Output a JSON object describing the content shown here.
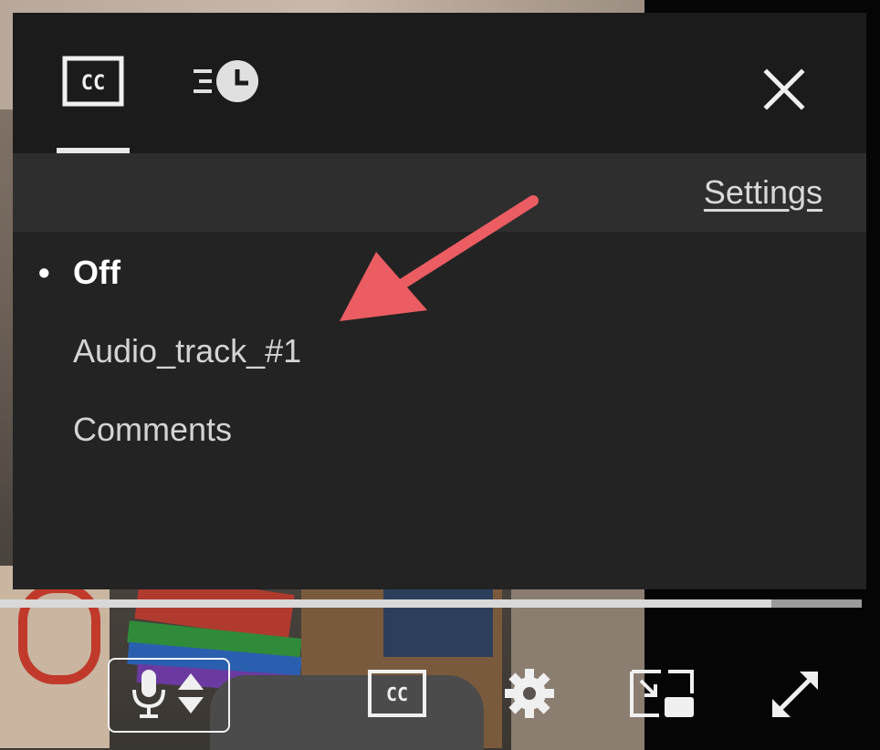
{
  "panel": {
    "tabs": [
      {
        "name": "captions",
        "icon": "closed-captions-icon",
        "selected": true
      },
      {
        "name": "speed",
        "icon": "playback-speed-icon",
        "selected": false
      }
    ],
    "close_icon": "close-icon",
    "settings_label": "Settings",
    "options": [
      {
        "label": "Off",
        "selected": true
      },
      {
        "label": "Audio_track_#1",
        "selected": false
      },
      {
        "label": "Comments",
        "selected": false
      }
    ],
    "bullet": "•"
  },
  "player": {
    "progress": 0.895,
    "controls": [
      {
        "name": "voice-control",
        "icon": "microphone-icon"
      },
      {
        "name": "captions",
        "icon": "closed-captions-icon"
      },
      {
        "name": "settings",
        "icon": "gear-icon"
      },
      {
        "name": "picture-in-picture",
        "icon": "picture-in-picture-icon"
      },
      {
        "name": "fullscreen",
        "icon": "expand-icon"
      }
    ]
  },
  "cc_text": "CC",
  "colors": {
    "panel_bg": "#232323",
    "tabbar_bg": "#1b1b1b",
    "settings_row_bg": "#2e2e2e",
    "annotation_arrow": "#ec5c63"
  }
}
